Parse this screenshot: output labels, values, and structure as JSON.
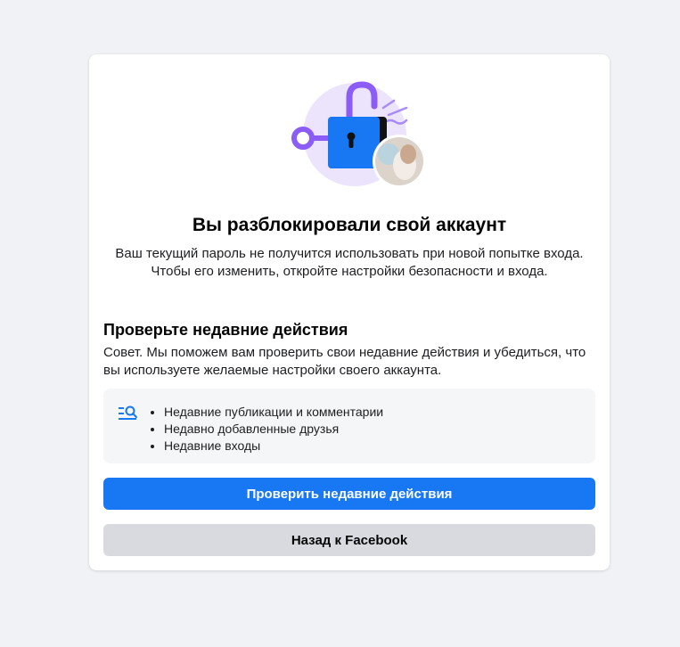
{
  "dialog": {
    "title": "Вы разблокировали свой аккаунт",
    "subtitle": "Ваш текущий пароль не получится использовать при новой попытке входа. Чтобы его изменить, откройте настройки безопасности и входа.",
    "illustration": "unlocked-padlock-with-key-and-profile-photo"
  },
  "recent_activity": {
    "heading": "Проверьте недавние действия",
    "description": "Совет. Мы поможем вам проверить свои недавние действия и убедиться, что вы используете желаемые настройки своего аккаунта.",
    "list_icon": "search-list-icon",
    "items": [
      "Недавние публикации и комментарии",
      "Недавно добавленные друзья",
      "Недавние входы"
    ]
  },
  "buttons": {
    "review_label": "Проверить недавние действия",
    "back_label": "Назад к Facebook"
  },
  "colors": {
    "primary": "#1877f2",
    "secondary_button": "#d8dadf",
    "lock_purple": "#8b5cf6",
    "background": "#f0f2f5"
  }
}
